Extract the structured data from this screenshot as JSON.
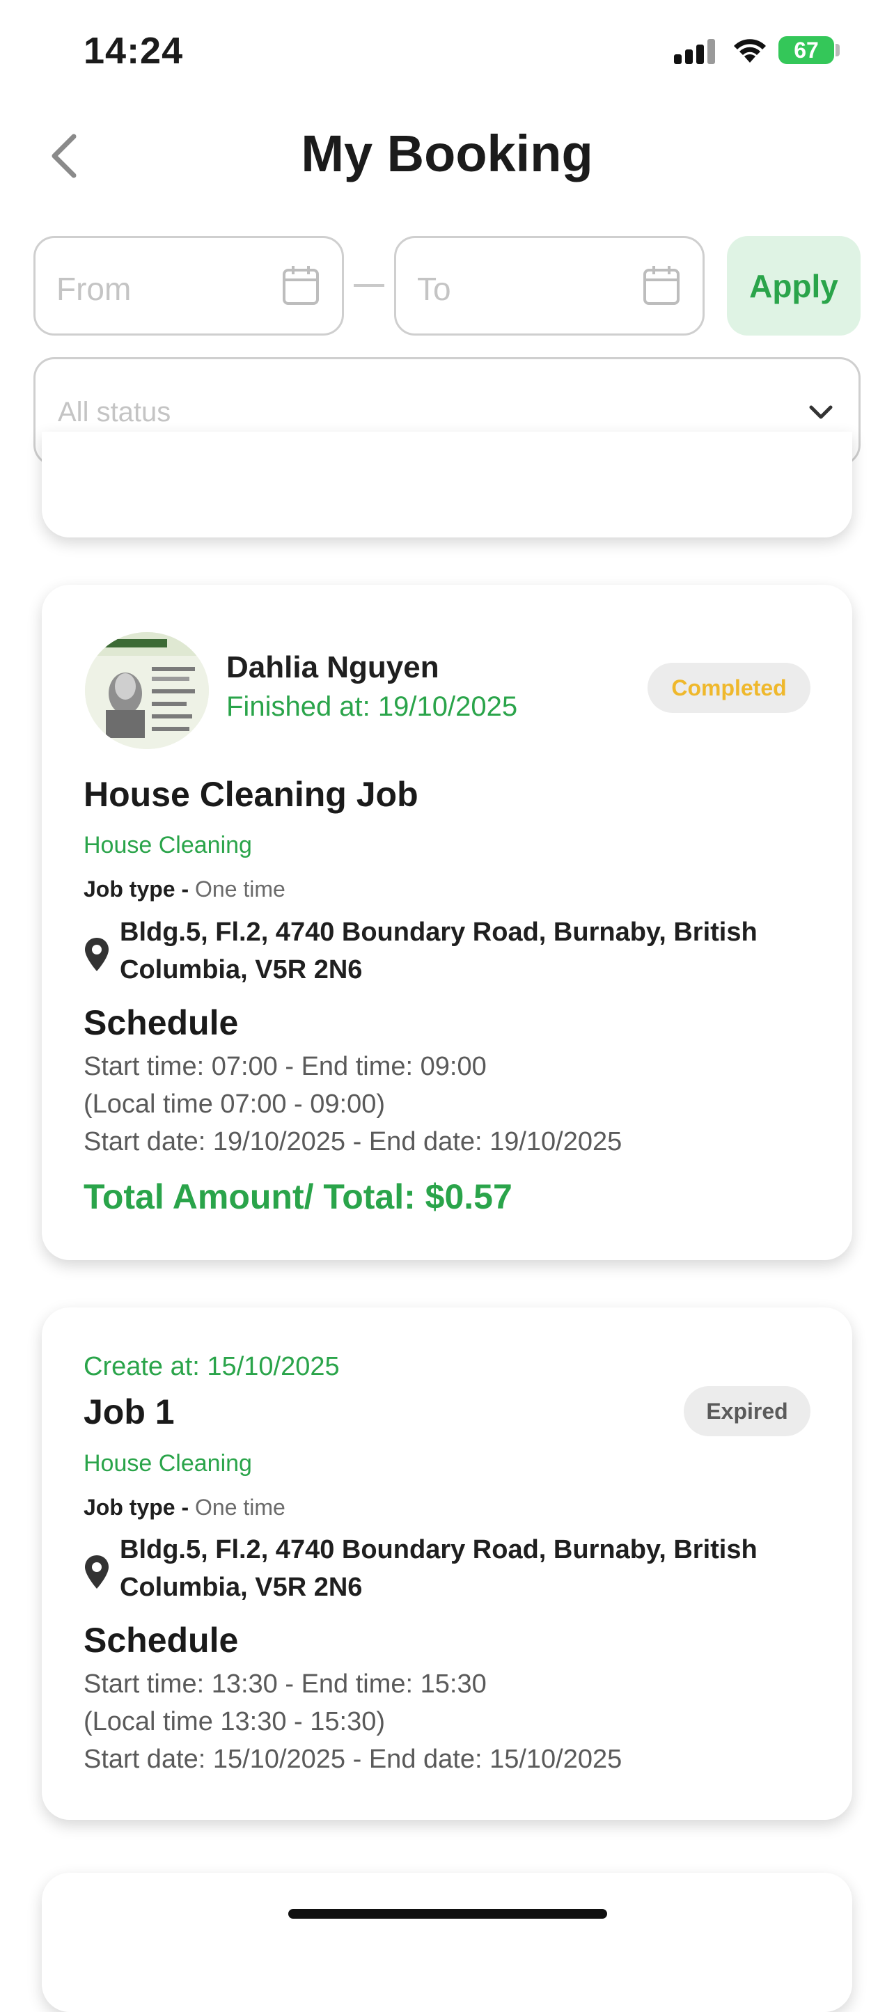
{
  "status_bar": {
    "time": "14:24",
    "battery": "67"
  },
  "header": {
    "title": "My Booking"
  },
  "filter": {
    "from_placeholder": "From",
    "to_placeholder": "To",
    "apply_label": "Apply",
    "status_placeholder": "All status"
  },
  "bookings": [
    {
      "customer_name": "Dahlia Nguyen",
      "finished_at": "Finished at: 19/10/2025",
      "status": "Completed",
      "title": "House Cleaning Job",
      "category": "House Cleaning",
      "job_type_label": "Job type -",
      "job_type": "One time",
      "address": "Bldg.5, Fl.2, 4740 Boundary Road, Burnaby, British Columbia, V5R 2N6",
      "schedule_heading": "Schedule",
      "time_line": "Start time: 07:00 - End time: 09:00",
      "local_time_line": "(Local time 07:00 - 09:00)",
      "date_line": "Start date: 19/10/2025 - End date: 19/10/2025",
      "total": "Total Amount/ Total: $0.57"
    },
    {
      "created_at": "Create at: 15/10/2025",
      "title": "Job 1",
      "status": "Expired",
      "category": "House Cleaning",
      "job_type_label": "Job type -",
      "job_type": "One time",
      "address": "Bldg.5, Fl.2, 4740 Boundary Road, Burnaby, British Columbia, V5R 2N6",
      "schedule_heading": "Schedule",
      "time_line": "Start time: 13:30 - End time: 15:30",
      "local_time_line": "(Local time 13:30 - 15:30)",
      "date_line": "Start date: 15/10/2025 - End date: 15/10/2025"
    }
  ],
  "colors": {
    "accent_green": "#2aa44a",
    "completed_yellow": "#efb82c",
    "apply_bg": "#dff3e4"
  },
  "icons": [
    "signal-icon",
    "wifi-icon",
    "battery-icon",
    "back-chevron-icon",
    "calendar-icon",
    "chevron-down-icon",
    "location-pin-icon"
  ]
}
